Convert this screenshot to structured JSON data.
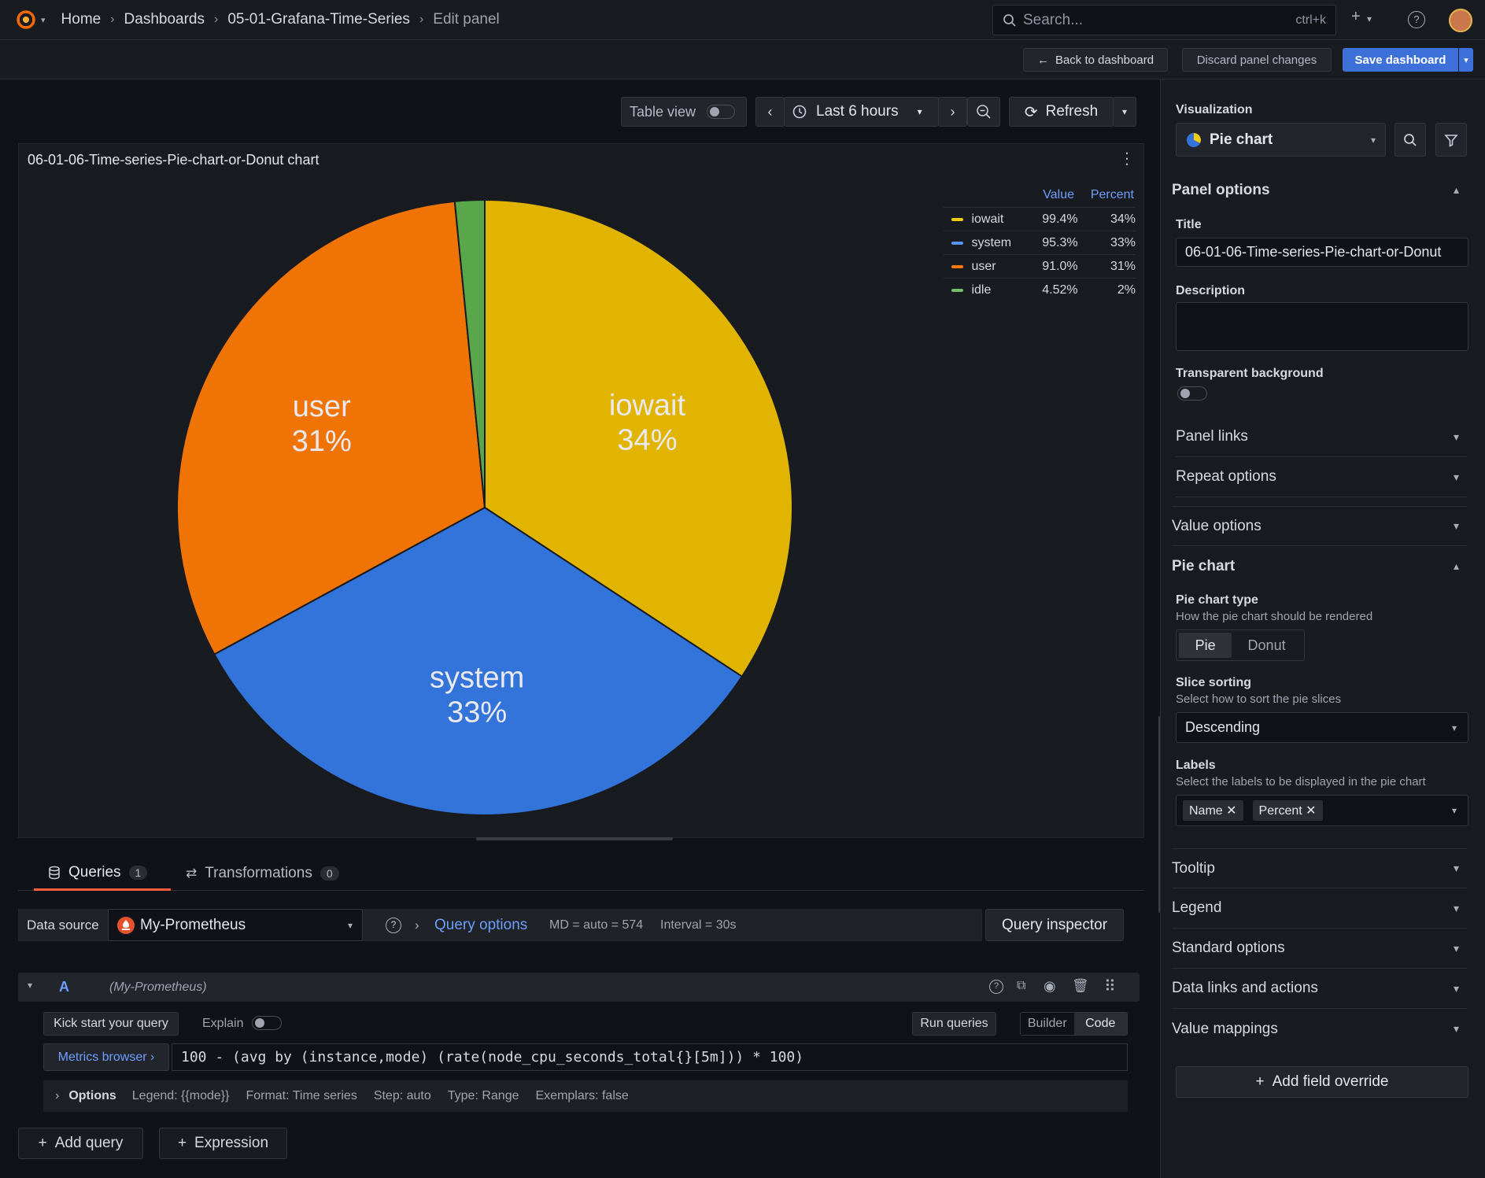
{
  "topbar": {
    "breadcrumb": [
      "Home",
      "Dashboards",
      "05-01-Grafana-Time-Series",
      "Edit panel"
    ],
    "search_placeholder": "Search...",
    "search_shortcut": "ctrl+k",
    "add_icon": "plus-icon",
    "help_icon": "help-icon"
  },
  "actions": {
    "back": "Back to dashboard",
    "discard": "Discard panel changes",
    "save": "Save dashboard"
  },
  "viz_toolbar": {
    "table_view": "Table view",
    "time_range": "Last 6 hours",
    "refresh": "Refresh"
  },
  "panel": {
    "title": "06-01-06-Time-series-Pie-chart-or-Donut chart",
    "legend_headers": {
      "value": "Value",
      "percent": "Percent"
    },
    "legend": [
      {
        "name": "iowait",
        "value": "99.4%",
        "percent": "34%",
        "color": "#f2cc0c"
      },
      {
        "name": "system",
        "value": "95.3%",
        "percent": "33%",
        "color": "#5794f2"
      },
      {
        "name": "user",
        "value": "91.0%",
        "percent": "31%",
        "color": "#ff780a"
      },
      {
        "name": "idle",
        "value": "4.52%",
        "percent": "2%",
        "color": "#73bf69"
      }
    ]
  },
  "chart_data": {
    "type": "pie",
    "categories": [
      "iowait",
      "system",
      "user",
      "idle"
    ],
    "values": [
      99.4,
      95.3,
      91.0,
      4.52
    ],
    "labels": [
      "34%",
      "33%",
      "31%",
      ""
    ],
    "colors": [
      "#e0b400",
      "#3274d9",
      "#f07306",
      "#5aa64b"
    ],
    "title": "06-01-06-Time-series-Pie-chart-or-Donut chart"
  },
  "queries_tabs": {
    "queries": "Queries",
    "queries_count": "1",
    "transformations": "Transformations",
    "transformations_count": "0"
  },
  "query_bar": {
    "data_source_label": "Data source",
    "data_source": "My-Prometheus",
    "query_options": "Query options",
    "md": "MD = auto = 574",
    "interval": "Interval = 30s",
    "inspector": "Query inspector"
  },
  "query_a": {
    "ref": "A",
    "ds": "(My-Prometheus)",
    "kick_start": "Kick start your query",
    "explain": "Explain",
    "run": "Run queries",
    "builder": "Builder",
    "code": "Code",
    "metrics_browser": "Metrics browser ›",
    "expr": "100 - (avg by (instance,mode) (rate(node_cpu_seconds_total{}[5m])) * 100)",
    "options_label": "Options",
    "options": [
      "Legend: {{mode}}",
      "Format: Time series",
      "Step: auto",
      "Type: Range",
      "Exemplars: false"
    ]
  },
  "bottom_buttons": {
    "add_query": "Add query",
    "expression": "Expression"
  },
  "right_pane": {
    "visualization_label": "Visualization",
    "visualization": "Pie chart",
    "panel_options": "Panel options",
    "title_label": "Title",
    "title_value": "06-01-06-Time-series-Pie-chart-or-Donut",
    "description_label": "Description",
    "transparent_label": "Transparent background",
    "panel_links": "Panel links",
    "repeat_options": "Repeat options",
    "value_options": "Value options",
    "pie_chart": "Pie chart",
    "pie_type_label": "Pie chart type",
    "pie_type_desc": "How the pie chart should be rendered",
    "pie": "Pie",
    "donut": "Donut",
    "slice_sorting_label": "Slice sorting",
    "slice_sorting_desc": "Select how to sort the pie slices",
    "slice_sorting": "Descending",
    "labels_label": "Labels",
    "labels_desc": "Select the labels to be displayed in the pie chart",
    "label_tags": [
      "Name",
      "Percent"
    ],
    "tooltip": "Tooltip",
    "legend": "Legend",
    "standard_options": "Standard options",
    "data_links": "Data links and actions",
    "value_mappings": "Value mappings",
    "add_override": "Add field override"
  }
}
